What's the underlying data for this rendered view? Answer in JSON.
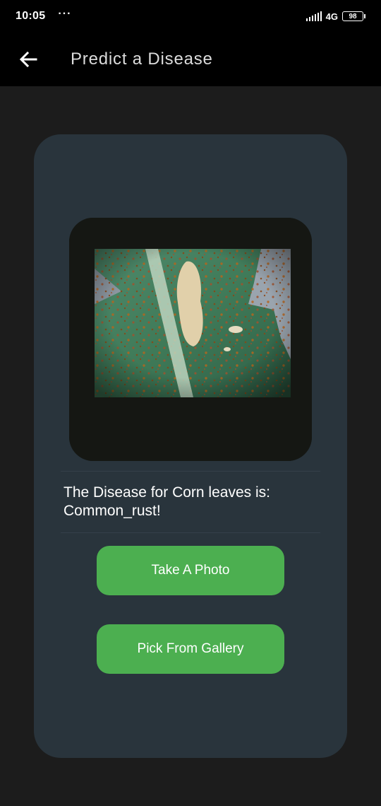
{
  "status_bar": {
    "time": "10:05",
    "dots": "···",
    "network": "4G",
    "battery": "98"
  },
  "app_bar": {
    "title": "Predict a Disease",
    "back_icon": "arrow-left-icon"
  },
  "prediction": {
    "result_text": "The Disease for Corn leaves is: Common_rust!"
  },
  "actions": {
    "take_photo_label": "Take A Photo",
    "pick_gallery_label": "Pick From Gallery"
  },
  "colors": {
    "background": "#1c1c1c",
    "app_bar": "#000000",
    "card": "#29343c",
    "button": "#4caf50"
  }
}
